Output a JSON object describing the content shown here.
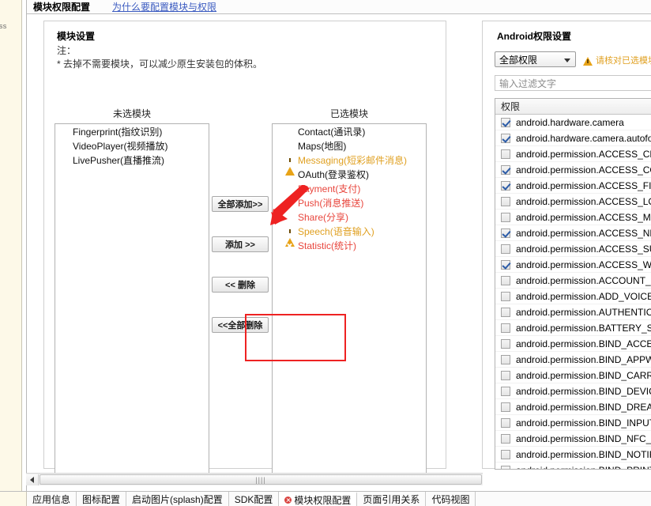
{
  "left_strip": {
    "text": "css"
  },
  "header": {
    "title": "模块权限配置",
    "help_link": "为什么要配置模块与权限"
  },
  "module_group": {
    "heading": "模块设置",
    "note_label": "注：",
    "note_text": "* 去掉不需要模块，可以减少原生安装包的体积。",
    "unselected_title": "未选模块",
    "selected_title": "已选模块",
    "unselected": [
      {
        "label": "Fingerprint(指纹识别)",
        "icon": "none",
        "color": "black"
      },
      {
        "label": "VideoPlayer(视频播放)",
        "icon": "none",
        "color": "black"
      },
      {
        "label": "LivePusher(直播推流)",
        "icon": "none",
        "color": "black"
      }
    ],
    "selected": [
      {
        "label": "Contact(通讯录)",
        "icon": "none",
        "color": "black"
      },
      {
        "label": "Maps(地图)",
        "icon": "none",
        "color": "black"
      },
      {
        "label": "Messaging(短彩邮件消息)",
        "icon": "warning-icon",
        "color": "amber"
      },
      {
        "label": "OAuth(登录鉴权)",
        "icon": "none",
        "color": "black"
      },
      {
        "label": "Payment(支付)",
        "icon": "error-icon",
        "color": "red"
      },
      {
        "label": "Push(消息推送)",
        "icon": "error-icon",
        "color": "red"
      },
      {
        "label": "Share(分享)",
        "icon": "error-icon",
        "color": "red"
      },
      {
        "label": "Speech(语音输入)",
        "icon": "warning-icon",
        "color": "amber"
      },
      {
        "label": "Statistic(统计)",
        "icon": "error-icon",
        "color": "red"
      }
    ],
    "buttons": {
      "add_all": "全部添加>>",
      "add": "添加  >>",
      "remove": "<< 删除",
      "remove_all": "<<全部删除"
    }
  },
  "annotation": {
    "rect_color": "#ee2222",
    "arrow_color": "#ee2222"
  },
  "permission_group": {
    "heading": "Android权限设置",
    "scope_select": {
      "value": "全部权限",
      "icon": "chevron-down-icon"
    },
    "warning": {
      "icon": "warning-icon",
      "text": "请核对已选模块列表"
    },
    "filter_placeholder": "输入过滤文字",
    "table_header": "权限",
    "rows": [
      {
        "name": "android.hardware.camera",
        "checked": true
      },
      {
        "name": "android.hardware.camera.autofocus",
        "checked": true
      },
      {
        "name": "android.permission.ACCESS_CHECKIN_PROPERTIES",
        "checked": false
      },
      {
        "name": "android.permission.ACCESS_COARSE_LOCATION",
        "checked": true
      },
      {
        "name": "android.permission.ACCESS_FINE_LOCATION",
        "checked": true
      },
      {
        "name": "android.permission.ACCESS_LOCATION_EXTRA_COMMANDS",
        "checked": false
      },
      {
        "name": "android.permission.ACCESS_MOCK_LOCATION",
        "checked": false
      },
      {
        "name": "android.permission.ACCESS_NETWORK_STATE",
        "checked": true
      },
      {
        "name": "android.permission.ACCESS_SURFACE_FLINGER",
        "checked": false
      },
      {
        "name": "android.permission.ACCESS_WIFI_STATE",
        "checked": true
      },
      {
        "name": "android.permission.ACCOUNT_MANAGER",
        "checked": false
      },
      {
        "name": "android.permission.ADD_VOICEMAIL",
        "checked": false
      },
      {
        "name": "android.permission.AUTHENTICATE_ACCOUNTS",
        "checked": false
      },
      {
        "name": "android.permission.BATTERY_STATS",
        "checked": false
      },
      {
        "name": "android.permission.BIND_ACCESSIBILITY_SERVICE",
        "checked": false
      },
      {
        "name": "android.permission.BIND_APPWIDGET",
        "checked": false
      },
      {
        "name": "android.permission.BIND_CARRIER_MESSAGING_SERVICE",
        "checked": false
      },
      {
        "name": "android.permission.BIND_DEVICE_ADMIN",
        "checked": false
      },
      {
        "name": "android.permission.BIND_DREAM_SERVICE",
        "checked": false
      },
      {
        "name": "android.permission.BIND_INPUT_METHOD",
        "checked": false
      },
      {
        "name": "android.permission.BIND_NFC_SERVICE",
        "checked": false
      },
      {
        "name": "android.permission.BIND_NOTIFICATION_LISTENER_SERVICE",
        "checked": false
      },
      {
        "name": "android.permission.BIND_PRINT_SERVICE",
        "checked": false
      }
    ]
  },
  "hscroll": {
    "left_arrow": "◄",
    "grip": "||||"
  },
  "tabs": [
    {
      "label": "应用信息",
      "active": false,
      "error": false
    },
    {
      "label": "图标配置",
      "active": false,
      "error": false
    },
    {
      "label": "启动图片(splash)配置",
      "active": false,
      "error": false
    },
    {
      "label": "SDK配置",
      "active": false,
      "error": false
    },
    {
      "label": "模块权限配置",
      "active": true,
      "error": true
    },
    {
      "label": "页面引用关系",
      "active": false,
      "error": false
    },
    {
      "label": "代码视图",
      "active": false,
      "error": false
    }
  ]
}
